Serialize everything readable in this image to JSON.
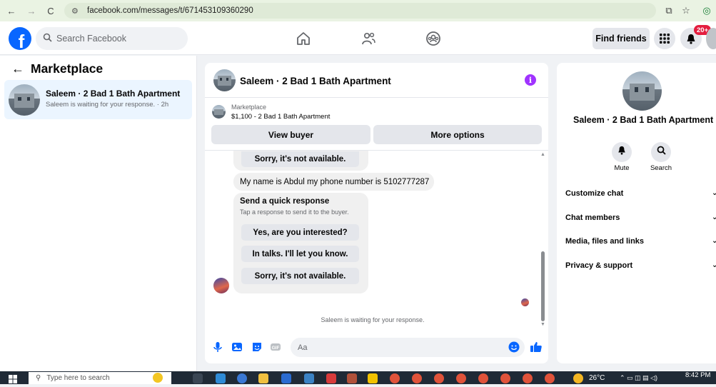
{
  "browser": {
    "url": "facebook.com/messages/t/671453109360290"
  },
  "header": {
    "search_placeholder": "Search Facebook",
    "find_friends_label": "Find friends",
    "notification_count": "20+",
    "brand_color": "#0866ff"
  },
  "left_panel": {
    "title": "Marketplace",
    "conversation": {
      "name": "Saleem · 2 Bad 1 Bath Apartment",
      "preview": "Saleem is waiting for your response. · 2h"
    }
  },
  "chat": {
    "title": "Saleem · 2 Bad 1 Bath Apartment",
    "listing_category": "Marketplace",
    "listing_desc": "$1,100 - 2 Bad 1 Bath Apartment",
    "view_buyer_label": "View buyer",
    "more_options_label": "More options",
    "messages": {
      "partial_reply": "Sorry, it's not available.",
      "auto_message": "My name is Abdul my phone number is 5102777287",
      "quick_title": "Send a quick response",
      "quick_subtitle": "Tap a response to send it to the buyer.",
      "quick_replies": [
        "Yes, are you interested?",
        "In talks. I'll let you know.",
        "Sorry, it's not available."
      ]
    },
    "waiting_text": "Saleem is waiting for your response.",
    "composer_placeholder": "Aa"
  },
  "right_panel": {
    "name": "Saleem · 2 Bad 1 Bath Apartment",
    "mute_label": "Mute",
    "search_label": "Search",
    "rows": [
      "Customize chat",
      "Chat members",
      "Media, files and links",
      "Privacy & support"
    ]
  },
  "taskbar": {
    "search_placeholder": "Type here to search",
    "temperature": "26°C",
    "time": "8:42 PM"
  }
}
